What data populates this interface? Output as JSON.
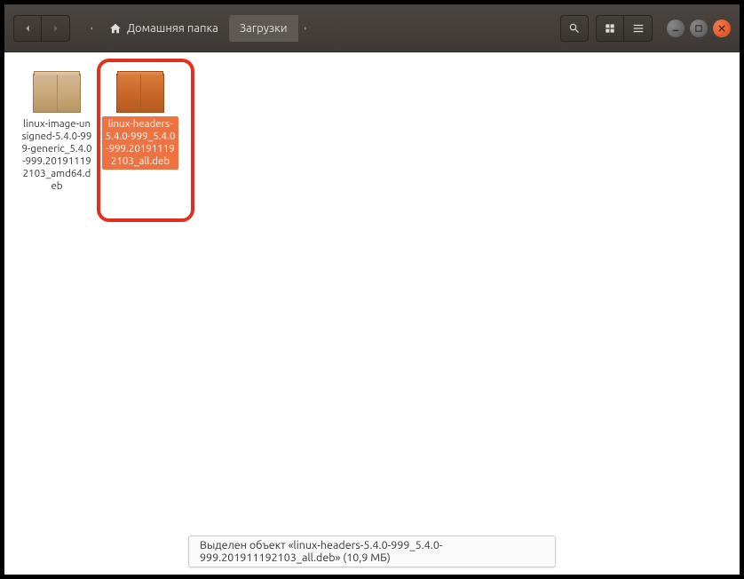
{
  "breadcrumb": {
    "home_label": "Домашняя папка",
    "current": "Загрузки"
  },
  "files": [
    {
      "label": "linux-image-unsigned-5.4.0-999-generic_5.4.0-999.201911192103_amd64.deb",
      "selected": false
    },
    {
      "label": "linux-headers-5.4.0-999_5.4.0-999.201911192103_all.deb",
      "selected": true
    }
  ],
  "status": {
    "text": "Выделен объект «linux-headers-5.4.0-999_5.4.0-999.201911192103_all.deb» (10,9 МБ)"
  },
  "icons": {
    "back": "back",
    "forward": "forward",
    "search": "search",
    "grid": "grid",
    "list": "list",
    "menu": "menu"
  }
}
